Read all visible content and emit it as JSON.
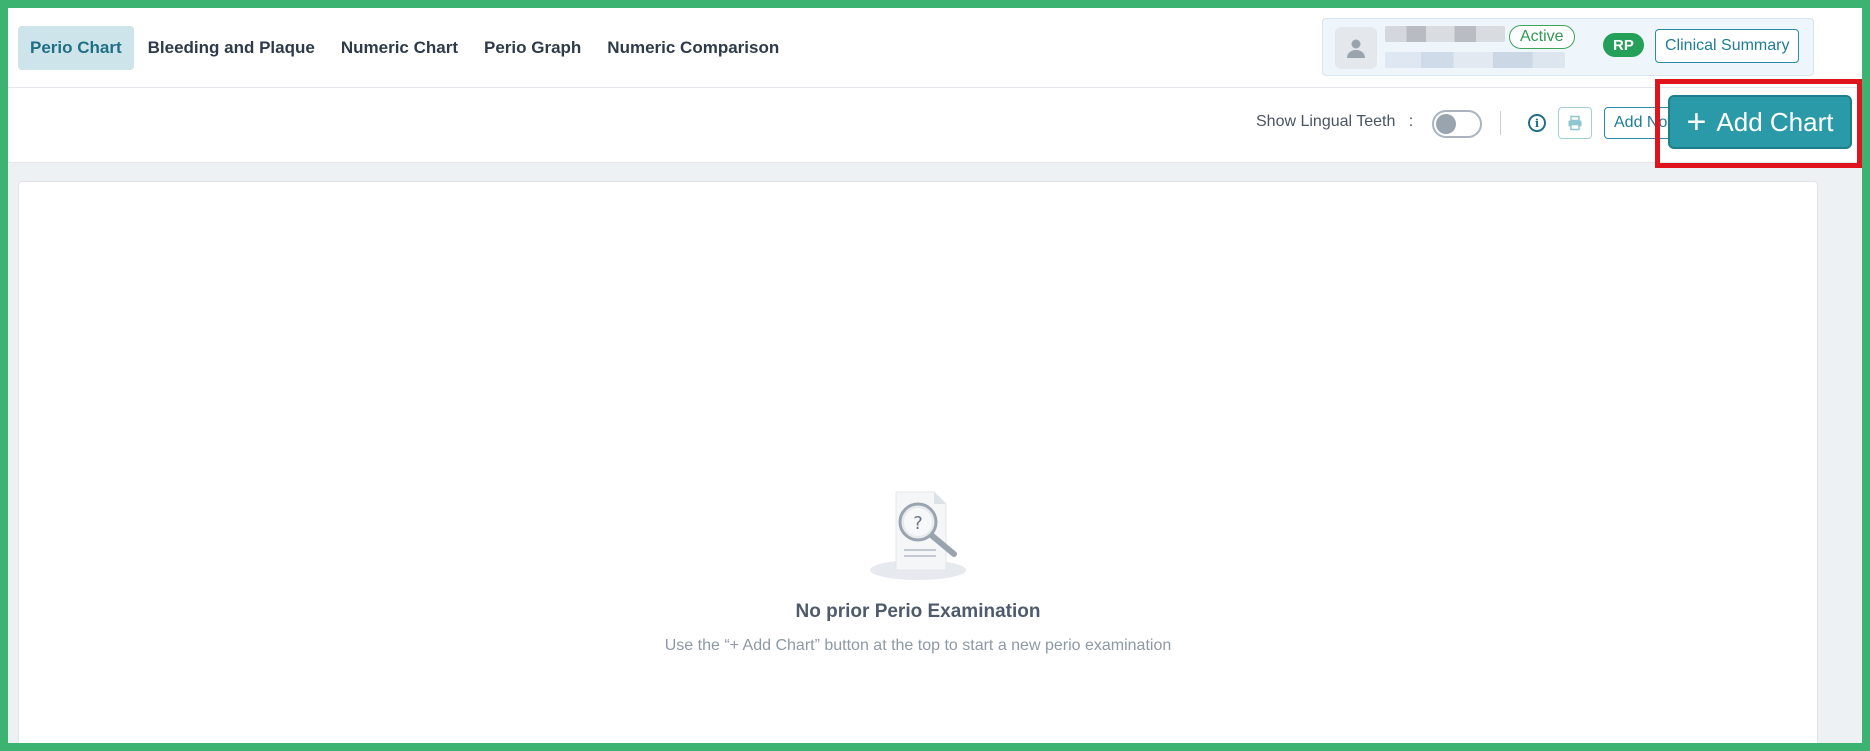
{
  "tabs": [
    {
      "label": "Perio Chart",
      "active": true
    },
    {
      "label": "Bleeding and Plaque",
      "active": false
    },
    {
      "label": "Numeric Chart",
      "active": false
    },
    {
      "label": "Perio Graph",
      "active": false
    },
    {
      "label": "Numeric Comparison",
      "active": false
    }
  ],
  "patient": {
    "status": "Active",
    "initials": "RP",
    "summary_label": "Clinical Summary"
  },
  "toolbar": {
    "lingual_label": "Show Lingual Teeth",
    "lingual_separator": ":",
    "lingual_on": false,
    "add_note_label": "Add Note",
    "add_chart_label": "Add Chart"
  },
  "empty_state": {
    "title": "No prior Perio Examination",
    "subtitle": "Use the “+ Add Chart” button at the top to start a new perio examination"
  },
  "colors": {
    "accent": "#2b9aa8",
    "active_tab_bg": "#cde5ea",
    "status_green": "#24a058",
    "highlight": "#e0141c",
    "frame": "#3cb371"
  }
}
